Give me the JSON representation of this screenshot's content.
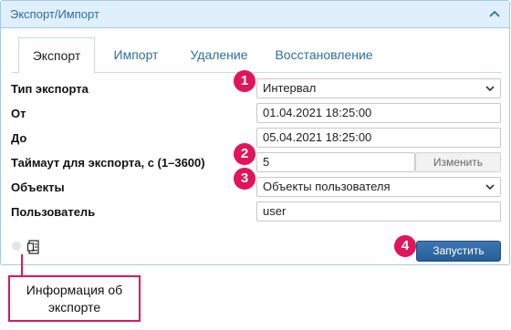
{
  "panel": {
    "title": "Экспорт/Импорт"
  },
  "tabs": [
    {
      "label": "Экспорт",
      "active": true
    },
    {
      "label": "Импорт",
      "active": false
    },
    {
      "label": "Удаление",
      "active": false
    },
    {
      "label": "Восстановление",
      "active": false
    }
  ],
  "form": {
    "export_type": {
      "label": "Тип экспорта",
      "value": "Интервал"
    },
    "from": {
      "label": "От",
      "value": "01.04.2021 18:25:00"
    },
    "to": {
      "label": "До",
      "value": "05.04.2021 18:25:00"
    },
    "timeout": {
      "label": "Таймаут для экспорта, с (1–3600)",
      "value": "5",
      "change_label": "Изменить"
    },
    "objects": {
      "label": "Объекты",
      "value": "Объекты пользователя"
    },
    "user": {
      "label": "Пользователь",
      "value": "user"
    }
  },
  "actions": {
    "run_label": "Запустить"
  },
  "markers": [
    "1",
    "2",
    "3",
    "4"
  ],
  "callout": {
    "text": "Информация об экспорте"
  },
  "colors": {
    "header_bg": "#dfeffc",
    "title": "#2e6e9e",
    "run_button": "#2a5e94",
    "marker": "#e0155a"
  },
  "icons": {
    "collapse": "chevron-up-icon",
    "dropdown": "chevron-down-icon",
    "info": "document-info-icon",
    "status": "status-dot"
  }
}
